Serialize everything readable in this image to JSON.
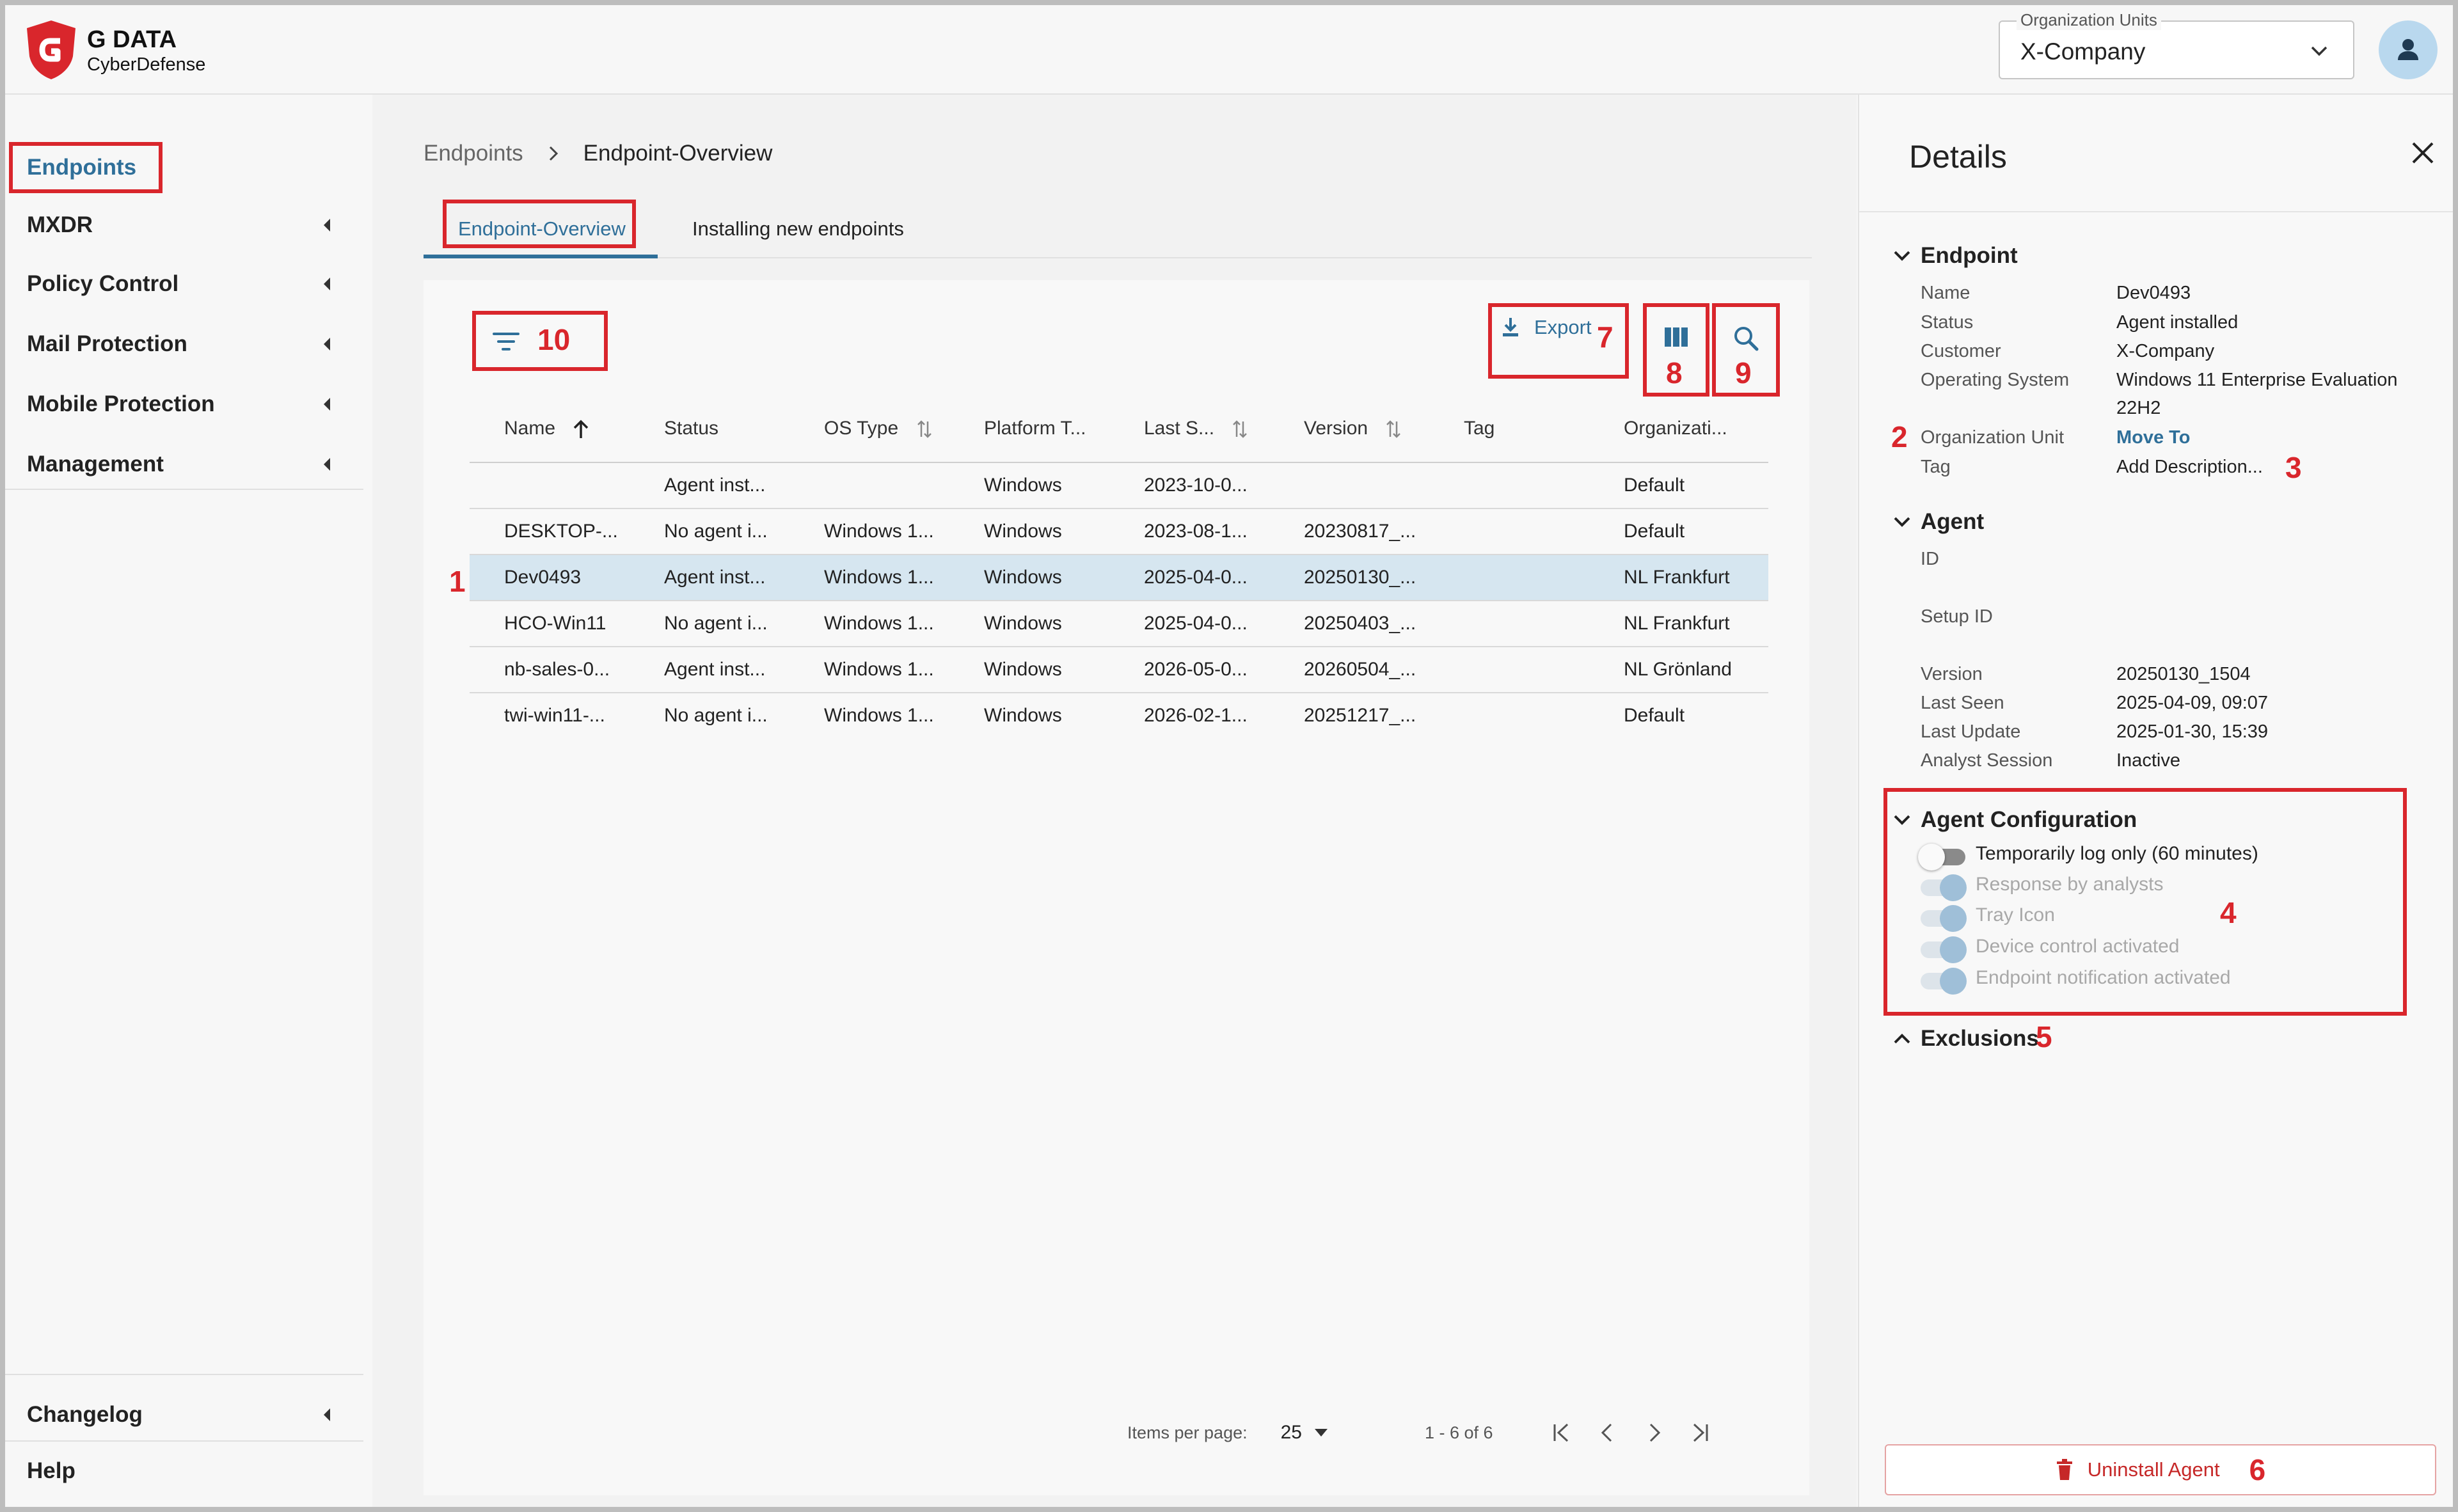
{
  "header": {
    "brand_name": "G DATA",
    "brand_sub": "CyberDefense",
    "org_label": "Organization Units",
    "org_value": "X-Company"
  },
  "sidebar": {
    "items": [
      {
        "label": "Endpoints"
      },
      {
        "label": "MXDR"
      },
      {
        "label": "Policy Control"
      },
      {
        "label": "Mail Protection"
      },
      {
        "label": "Mobile Protection"
      },
      {
        "label": "Management"
      }
    ],
    "bottom": [
      {
        "label": "Changelog"
      },
      {
        "label": "Help"
      }
    ]
  },
  "breadcrumb": {
    "root": "Endpoints",
    "current": "Endpoint-Overview"
  },
  "tabs": [
    {
      "label": "Endpoint-Overview"
    },
    {
      "label": "Installing new endpoints"
    }
  ],
  "toolbar": {
    "export_label": "Export"
  },
  "annotations": {
    "n1": "1",
    "n2": "2",
    "n3": "3",
    "n4": "4",
    "n5": "5",
    "n6": "6",
    "n7": "7",
    "n8": "8",
    "n9": "9",
    "n10": "10"
  },
  "table": {
    "columns": [
      "Name",
      "Status",
      "OS Type",
      "Platform T...",
      "Last S...",
      "Version",
      "Tag",
      "Organizati..."
    ],
    "rows": [
      [
        "",
        "Agent inst...",
        "",
        "Windows",
        "2023-10-0...",
        "",
        "",
        "Default"
      ],
      [
        "DESKTOP-...",
        "No agent i...",
        "Windows 1...",
        "Windows",
        "2023-08-1...",
        "20230817_...",
        "",
        "Default"
      ],
      [
        "Dev0493",
        "Agent inst...",
        "Windows 1...",
        "Windows",
        "2025-04-0...",
        "20250130_...",
        "",
        "NL Frankfurt"
      ],
      [
        "HCO-Win11",
        "No agent i...",
        "Windows 1...",
        "Windows",
        "2025-04-0...",
        "20250403_...",
        "",
        "NL Frankfurt"
      ],
      [
        "nb-sales-0...",
        "Agent inst...",
        "Windows 1...",
        "Windows",
        "2026-05-0...",
        "20260504_...",
        "",
        "NL Grönland"
      ],
      [
        "twi-win11-...",
        "No agent i...",
        "Windows 1...",
        "Windows",
        "2026-02-1...",
        "20251217_...",
        "",
        "Default"
      ]
    ]
  },
  "paginator": {
    "items_per_page_label": "Items per page:",
    "items_per_page": "25",
    "range": "1 - 6 of 6"
  },
  "details": {
    "title": "Details",
    "endpoint_head": "Endpoint",
    "endpoint": {
      "name_label": "Name",
      "name": "Dev0493",
      "status_label": "Status",
      "status": "Agent installed",
      "customer_label": "Customer",
      "customer": "X-Company",
      "os_label": "Operating System",
      "os_line1": "Windows 11 Enterprise Evaluation",
      "os_line2": "22H2",
      "org_unit_label": "Organization Unit",
      "org_unit": "Move To",
      "tag_label": "Tag",
      "tag": "Add Description..."
    },
    "agent_head": "Agent",
    "agent": {
      "id_label": "ID",
      "setup_id_label": "Setup ID",
      "version_label": "Version",
      "version": "20250130_1504",
      "last_seen_label": "Last Seen",
      "last_seen": "2025-04-09, 09:07",
      "last_update_label": "Last Update",
      "last_update": "2025-01-30, 15:39",
      "analyst_label": "Analyst Session",
      "analyst": "Inactive"
    },
    "config_head": "Agent Configuration",
    "config": [
      {
        "label": "Temporarily log only (60 minutes)",
        "on": false,
        "disabled": false
      },
      {
        "label": "Response by analysts",
        "on": true,
        "disabled": true
      },
      {
        "label": "Tray Icon",
        "on": true,
        "disabled": true
      },
      {
        "label": "Device control activated",
        "on": true,
        "disabled": true
      },
      {
        "label": "Endpoint notification activated",
        "on": true,
        "disabled": true
      }
    ],
    "exclusions_head": "Exclusions",
    "uninstall_label": "Uninstall Agent"
  },
  "colors": {
    "accent": "#2f6f99",
    "annotation": "#d9262c",
    "selected_row": "#d6e6f0",
    "danger": "#c62828"
  }
}
